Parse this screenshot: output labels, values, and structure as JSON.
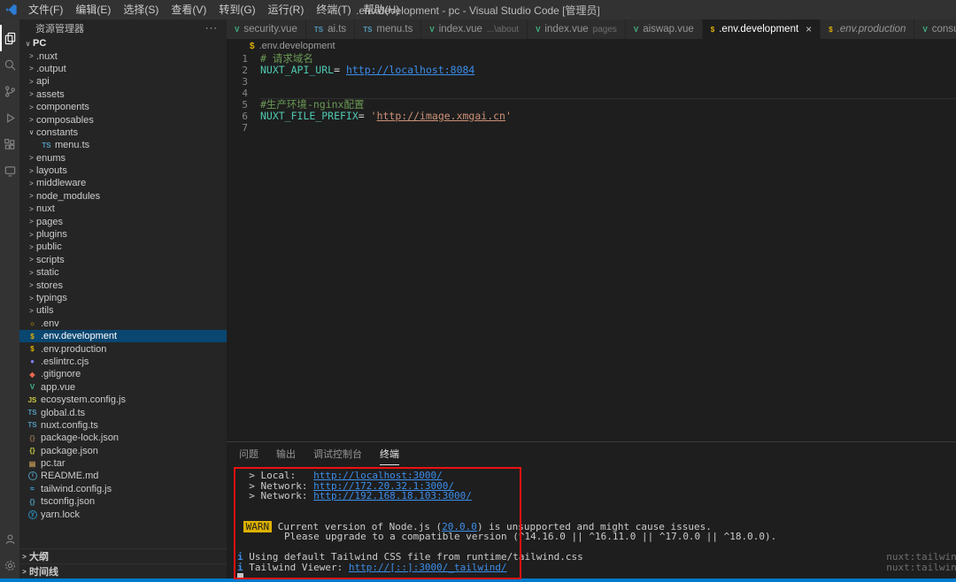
{
  "window": {
    "title": ".env.development - pc - Visual Studio Code [管理员]"
  },
  "menubar": {
    "items": [
      "文件(F)",
      "编辑(E)",
      "选择(S)",
      "查看(V)",
      "转到(G)",
      "运行(R)",
      "终端(T)",
      "帮助(H)"
    ]
  },
  "activity_bar": {
    "top": [
      {
        "name": "explorer",
        "active": true
      },
      {
        "name": "search"
      },
      {
        "name": "source-control"
      },
      {
        "name": "run-debug"
      },
      {
        "name": "extensions"
      },
      {
        "name": "remote-explorer"
      }
    ],
    "bottom": [
      {
        "name": "account"
      },
      {
        "name": "settings"
      }
    ]
  },
  "sidebar": {
    "title": "资源管理器",
    "more": "···",
    "items": [
      {
        "label": "PC",
        "kind": "root",
        "depth": 0,
        "expanded": true
      },
      {
        "label": ".nuxt",
        "kind": "folder",
        "depth": 1
      },
      {
        "label": ".output",
        "kind": "folder",
        "depth": 1
      },
      {
        "label": "api",
        "kind": "folder",
        "depth": 1
      },
      {
        "label": "assets",
        "kind": "folder",
        "depth": 1
      },
      {
        "label": "components",
        "kind": "folder",
        "depth": 1
      },
      {
        "label": "composables",
        "kind": "folder",
        "depth": 1
      },
      {
        "label": "constants",
        "kind": "folder",
        "depth": 1,
        "expanded": true
      },
      {
        "label": "menu.ts",
        "kind": "file",
        "depth": 2,
        "icon_name": "typescript-icon",
        "icon": {
          "g": "TS",
          "c": "#519aba"
        }
      },
      {
        "label": "enums",
        "kind": "folder",
        "depth": 1
      },
      {
        "label": "layouts",
        "kind": "folder",
        "depth": 1
      },
      {
        "label": "middleware",
        "kind": "folder",
        "depth": 1
      },
      {
        "label": "node_modules",
        "kind": "folder",
        "depth": 1
      },
      {
        "label": "nuxt",
        "kind": "folder",
        "depth": 1
      },
      {
        "label": "pages",
        "kind": "folder",
        "depth": 1
      },
      {
        "label": "plugins",
        "kind": "folder",
        "depth": 1
      },
      {
        "label": "public",
        "kind": "folder",
        "depth": 1
      },
      {
        "label": "scripts",
        "kind": "folder",
        "depth": 1
      },
      {
        "label": "static",
        "kind": "folder",
        "depth": 1
      },
      {
        "label": "stores",
        "kind": "folder",
        "depth": 1
      },
      {
        "label": "typings",
        "kind": "folder",
        "depth": 1
      },
      {
        "label": "utils",
        "kind": "folder",
        "depth": 1
      },
      {
        "label": ".env",
        "kind": "file",
        "depth": 1,
        "icon_name": "gear-icon",
        "icon": {
          "g": "☼",
          "c": "#ddb100"
        }
      },
      {
        "label": ".env.development",
        "kind": "file",
        "depth": 1,
        "selected": true,
        "icon_name": "env-icon",
        "icon": {
          "g": "$",
          "c": "#ddb100"
        }
      },
      {
        "label": ".env.production",
        "kind": "file",
        "depth": 1,
        "icon_name": "env-icon",
        "icon": {
          "g": "$",
          "c": "#ddb100"
        }
      },
      {
        "label": ".eslintrc.cjs",
        "kind": "file",
        "depth": 1,
        "icon_name": "eslint-icon",
        "icon": {
          "g": "●",
          "c": "#8080f2"
        }
      },
      {
        "label": ".gitignore",
        "kind": "file",
        "depth": 1,
        "icon_name": "git-icon",
        "icon": {
          "g": "◆",
          "c": "#e8694f"
        }
      },
      {
        "label": "app.vue",
        "kind": "file",
        "depth": 1,
        "icon_name": "vue-icon",
        "icon": {
          "g": "V",
          "c": "#41b883"
        }
      },
      {
        "label": "ecosystem.config.js",
        "kind": "file",
        "depth": 1,
        "icon_name": "javascript-icon",
        "icon": {
          "g": "JS",
          "c": "#cbcb41"
        }
      },
      {
        "label": "global.d.ts",
        "kind": "file",
        "depth": 1,
        "icon_name": "typescript-icon",
        "icon": {
          "g": "TS",
          "c": "#519aba"
        }
      },
      {
        "label": "nuxt.config.ts",
        "kind": "file",
        "depth": 1,
        "icon_name": "typescript-icon",
        "icon": {
          "g": "TS",
          "c": "#519aba"
        }
      },
      {
        "label": "package-lock.json",
        "kind": "file",
        "depth": 1,
        "icon_name": "json-icon",
        "icon": {
          "g": "{}",
          "c": "#8d6e4e"
        }
      },
      {
        "label": "package.json",
        "kind": "file",
        "depth": 1,
        "icon_name": "json-icon",
        "icon": {
          "g": "{}",
          "c": "#cbcb41"
        }
      },
      {
        "label": "pc.tar",
        "kind": "file",
        "depth": 1,
        "icon_name": "archive-icon",
        "icon": {
          "g": "▤",
          "c": "#c09553"
        }
      },
      {
        "label": "README.md",
        "kind": "file",
        "depth": 1,
        "icon_name": "readme-icon",
        "icon": {
          "g": "i",
          "c": "#519aba",
          "circle": true
        }
      },
      {
        "label": "tailwind.config.js",
        "kind": "file",
        "depth": 1,
        "icon_name": "tailwind-icon",
        "icon": {
          "g": "≈",
          "c": "#38bdf8"
        }
      },
      {
        "label": "tsconfig.json",
        "kind": "file",
        "depth": 1,
        "icon_name": "json-icon",
        "icon": {
          "g": "{}",
          "c": "#519aba"
        }
      },
      {
        "label": "yarn.lock",
        "kind": "file",
        "depth": 1,
        "icon_name": "yarn-icon",
        "icon": {
          "g": "y",
          "c": "#2c8ebb",
          "circle": true
        }
      }
    ],
    "footer": [
      {
        "label": "大纲"
      },
      {
        "label": "时间线"
      }
    ]
  },
  "tabs": [
    {
      "label": "security.vue",
      "icon": "vue"
    },
    {
      "label": "ai.ts",
      "icon": "ts"
    },
    {
      "label": "menu.ts",
      "icon": "ts"
    },
    {
      "label": "index.vue",
      "suffix": "...\\about",
      "icon": "vue"
    },
    {
      "label": "index.vue",
      "suffix": "pages",
      "icon": "vue"
    },
    {
      "label": "aiswap.vue",
      "icon": "vue"
    },
    {
      "label": ".env.development",
      "icon": "env",
      "active": true,
      "close": "×"
    },
    {
      "label": ".env.production",
      "icon": "env",
      "preview": true
    },
    {
      "label": "consumred.vue",
      "icon": "vue"
    }
  ],
  "breadcrumb": {
    "icon": "$",
    "label": ".env.development"
  },
  "editor": {
    "lines": [
      {
        "num": 1,
        "segs": [
          {
            "t": "# 请求域名",
            "c": "comment"
          }
        ]
      },
      {
        "num": 2,
        "segs": [
          {
            "t": "NUXT_API_URL",
            "c": "var"
          },
          {
            "t": "= ",
            "c": "op"
          },
          {
            "t": "http://localhost:8084",
            "c": "link"
          }
        ]
      },
      {
        "num": 3,
        "segs": []
      },
      {
        "num": 4,
        "segs": [],
        "rule": true
      },
      {
        "num": 5,
        "segs": [
          {
            "t": "#生产环境-nginx配置",
            "c": "comment"
          }
        ]
      },
      {
        "num": 6,
        "segs": [
          {
            "t": "NUXT_FILE_PREFIX",
            "c": "var"
          },
          {
            "t": "= ",
            "c": "op"
          },
          {
            "t": "'",
            "c": "string"
          },
          {
            "t": "http://image.xmgai.cn",
            "c": "stringlink"
          },
          {
            "t": "'",
            "c": "string"
          }
        ]
      },
      {
        "num": 7,
        "segs": []
      }
    ]
  },
  "panel": {
    "tabs": [
      "问题",
      "输出",
      "调试控制台",
      "终端"
    ],
    "active_index": 3,
    "terminal": {
      "lines": [
        {
          "segs": [
            {
              "t": "  > Local:   ",
              "c": "default"
            },
            {
              "t": "http://localhost:3000/",
              "c": "link"
            }
          ]
        },
        {
          "segs": [
            {
              "t": "  > Network: ",
              "c": "default"
            },
            {
              "t": "http://172.20.32.1:3000/",
              "c": "link"
            }
          ]
        },
        {
          "segs": [
            {
              "t": "  > Network: ",
              "c": "default"
            },
            {
              "t": "http://192.168.18.103:3000/",
              "c": "link"
            }
          ]
        },
        {
          "segs": []
        },
        {
          "segs": []
        },
        {
          "segs": [
            {
              "t": " ",
              "c": "default"
            },
            {
              "t": "WARN",
              "c": "warnbadge"
            },
            {
              "t": " Current version of Node.js (",
              "c": "default"
            },
            {
              "t": "20.0.0",
              "c": "link"
            },
            {
              "t": ") is unsupported and might cause issues.",
              "c": "default"
            }
          ]
        },
        {
          "segs": [
            {
              "t": "        Please upgrade to a compatible version (^14.16.0 || ^16.11.0 || ^17.0.0 || ^18.0.0).",
              "c": "default"
            }
          ]
        },
        {
          "segs": []
        },
        {
          "segs": [
            {
              "t": "i",
              "c": "info"
            },
            {
              "t": " Using default Tailwind CSS file from runtime/tailwind.css",
              "c": "default"
            }
          ],
          "tag": "nuxt:tailwindc"
        },
        {
          "segs": [
            {
              "t": "i",
              "c": "info"
            },
            {
              "t": " Tailwind Viewer: ",
              "c": "default"
            },
            {
              "t": "http://[::]:3000/_tailwind/",
              "c": "link"
            }
          ],
          "tag": "nuxt:tailwindc"
        },
        {
          "segs": [],
          "cursor": true
        }
      ]
    }
  },
  "colors": {
    "status_bar": "#007acc",
    "link": "#3b8eea",
    "comment": "#6a9955",
    "variable": "#4ec9b0",
    "string": "#ce9178",
    "warn_badge_bg": "#ddb100",
    "vue_green": "#41b883",
    "ts_blue": "#519aba",
    "env_yellow": "#ddb100",
    "selection_bg": "#094771",
    "annotation_red": "#ee1111"
  }
}
